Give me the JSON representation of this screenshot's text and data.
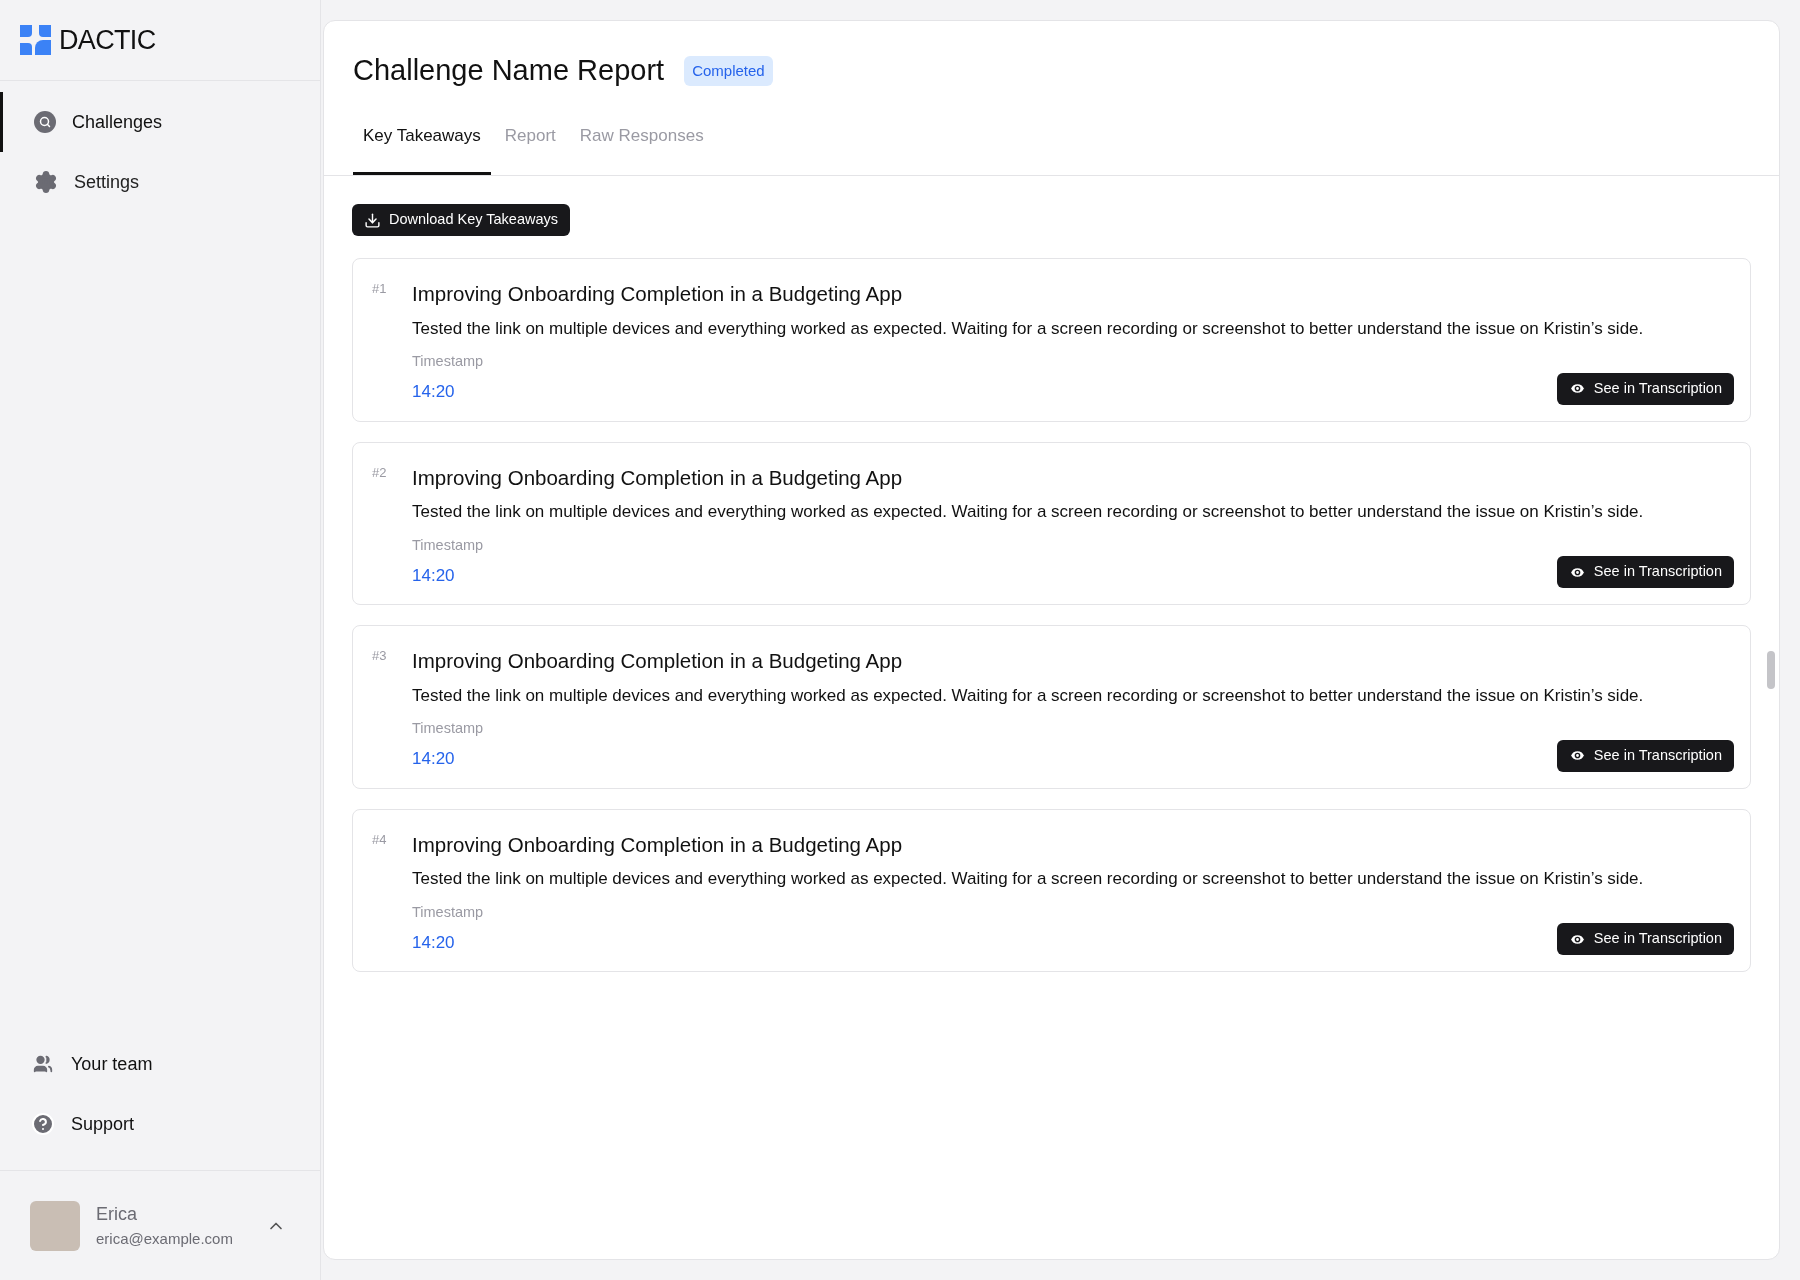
{
  "brand": {
    "name": "DACTIC"
  },
  "sidebar": {
    "items": [
      {
        "label": "Challenges",
        "kind": "search",
        "selected": true
      },
      {
        "label": "Settings",
        "kind": "gear",
        "selected": false
      }
    ],
    "bottom_items": [
      {
        "label": "Your team",
        "kind": "team"
      },
      {
        "label": "Support",
        "kind": "help"
      }
    ],
    "user": {
      "name": "Erica",
      "email": "erica@example.com",
      "expanded": true
    }
  },
  "header": {
    "title": "Challenge Name Report",
    "status": "Completed"
  },
  "tabs": [
    {
      "label": "Key Takeaways",
      "selected": true
    },
    {
      "label": "Report",
      "selected": false
    },
    {
      "label": "Raw Responses",
      "selected": false
    }
  ],
  "download_button": "Download Key Takeaways",
  "takeaways": [
    {
      "number": "#1",
      "title": "Improving Onboarding Completion in a Budgeting App",
      "text": "Tested the link on multiple devices and everything worked as expected. Waiting for a screen recording or screenshot to better understand the issue on Kristin’s side.",
      "timestamp_label": "Timestamp",
      "time": "14:20",
      "action": "See in Transcription"
    },
    {
      "number": "#2",
      "title": "Improving Onboarding Completion in a Budgeting App",
      "text": "Tested the link on multiple devices and everything worked as expected. Waiting for a screen recording or screenshot to better understand the issue on Kristin’s side.",
      "timestamp_label": "Timestamp",
      "time": "14:20",
      "action": "See in Transcription"
    },
    {
      "number": "#3",
      "title": "Improving Onboarding Completion in a Budgeting App",
      "text": "Tested the link on multiple devices and everything worked as expected. Waiting for a screen recording or screenshot to better understand the issue on Kristin’s side.",
      "timestamp_label": "Timestamp",
      "time": "14:20",
      "action": "See in Transcription"
    },
    {
      "number": "#4",
      "title": "Improving Onboarding Completion in a Budgeting App",
      "text": "Tested the link on multiple devices and everything worked as expected. Waiting for a screen recording or screenshot to better understand the issue on Kristin’s side.",
      "timestamp_label": "Timestamp",
      "time": "14:20",
      "action": "See in Transcription"
    }
  ]
}
